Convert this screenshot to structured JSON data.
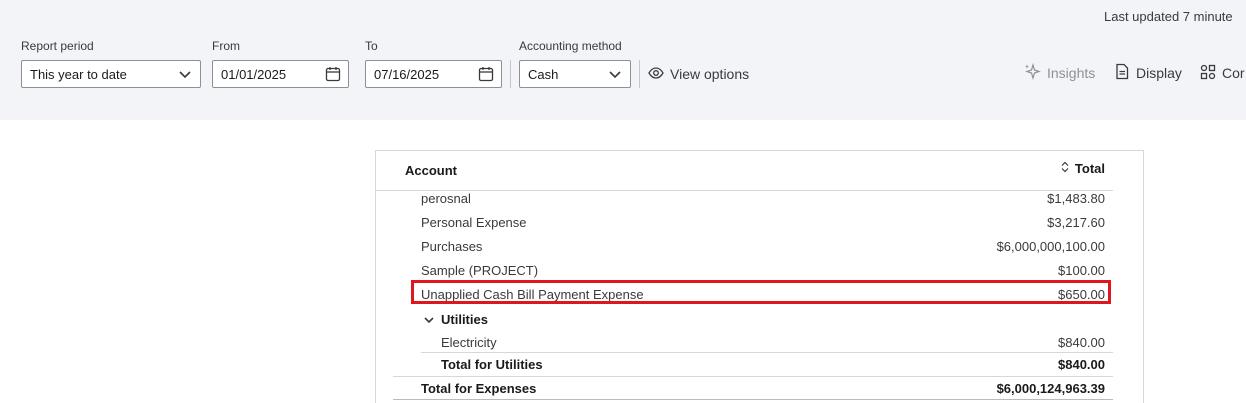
{
  "header": {
    "last_updated": "Last updated 7 minute"
  },
  "filters": {
    "report_period": {
      "label": "Report period",
      "value": "This year to date"
    },
    "from": {
      "label": "From",
      "value": "01/01/2025"
    },
    "to": {
      "label": "To",
      "value": "07/16/2025"
    },
    "accounting_method": {
      "label": "Accounting method",
      "value": "Cash"
    },
    "view_options_label": "View options"
  },
  "tools": {
    "insights_label": "Insights",
    "display_label": "Display",
    "compare_label": "Cor"
  },
  "table": {
    "headers": {
      "account": "Account",
      "total": "Total"
    },
    "rows": [
      {
        "name": "perosnal",
        "amount": "$1,483.80"
      },
      {
        "name": "Personal Expense",
        "amount": "$3,217.60"
      },
      {
        "name": "Purchases",
        "amount": "$6,000,000,100.00"
      },
      {
        "name": "Sample (PROJECT)",
        "amount": "$100.00"
      },
      {
        "name": "Unapplied Cash Bill Payment Expense",
        "amount": "$650.00"
      },
      {
        "name": "Utilities",
        "amount": ""
      },
      {
        "name": "Electricity",
        "amount": "$840.00"
      },
      {
        "name": "Total for Utilities",
        "amount": "$840.00"
      },
      {
        "name": "Total for Expenses",
        "amount": "$6,000,124,963.39"
      }
    ]
  },
  "colors": {
    "highlight": "#e0161f",
    "toolbar_bg": "#f3f4f8"
  }
}
